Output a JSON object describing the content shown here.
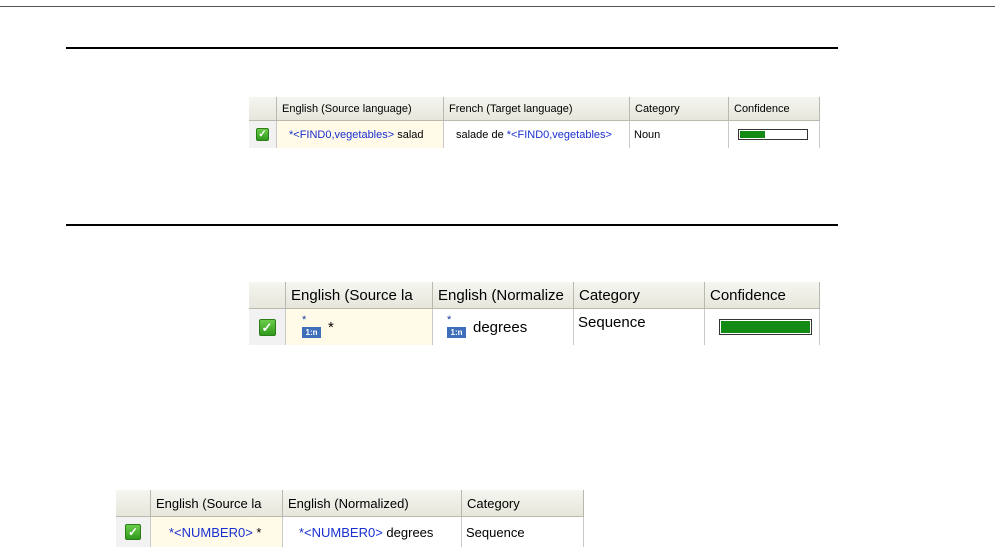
{
  "table1": {
    "headers": [
      "English (Source language)",
      "French (Target language)",
      "Category",
      "Confidence"
    ],
    "row": {
      "source_tag": "*<FIND0,vegetables>",
      "source_text": " salad",
      "target_text": "salade de ",
      "target_tag": "*<FIND0,vegetables>",
      "category": "Noun",
      "confidence": 0.4
    }
  },
  "table2": {
    "headers": [
      "English (Source la",
      "English (Normalize",
      "Category",
      "Confidence"
    ],
    "row": {
      "source_icon": "tag-icon",
      "source_text": "*",
      "normalized_icon": "tag-icon",
      "normalized_text": "degrees",
      "category": "Sequence",
      "confidence": 1.0
    }
  },
  "table3": {
    "headers": [
      "English (Source la",
      "English (Normalized)",
      "Category"
    ],
    "row": {
      "source_tag": "*<NUMBER0>",
      "source_text": " *",
      "normalized_tag": "*<NUMBER0>",
      "normalized_text": " degrees",
      "category": "Sequence"
    }
  },
  "colors": {
    "tag": "#1a2fd0",
    "check": "#3aa526",
    "confidence_fill": "#138a13"
  }
}
